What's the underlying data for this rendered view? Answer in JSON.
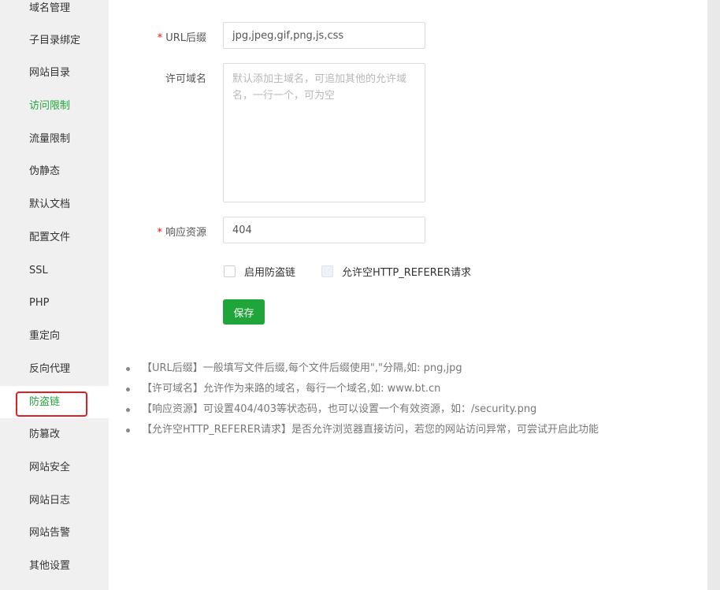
{
  "sidebar": {
    "items": [
      {
        "label": "域名管理"
      },
      {
        "label": "子目录绑定"
      },
      {
        "label": "网站目录"
      },
      {
        "label": "访问限制"
      },
      {
        "label": "流量限制"
      },
      {
        "label": "伪静态"
      },
      {
        "label": "默认文档"
      },
      {
        "label": "配置文件"
      },
      {
        "label": "SSL"
      },
      {
        "label": "PHP"
      },
      {
        "label": "重定向"
      },
      {
        "label": "反向代理"
      },
      {
        "label": "防盗链"
      },
      {
        "label": "防篡改"
      },
      {
        "label": "网站安全"
      },
      {
        "label": "网站日志"
      },
      {
        "label": "网站告警"
      },
      {
        "label": "其他设置"
      }
    ],
    "selected": "防盗链"
  },
  "form": {
    "required_mark": "*",
    "url_suffix": {
      "label": "URL后缀",
      "value": "jpg,jpeg,gif,png,js,css"
    },
    "allowed_domains": {
      "label": "许可域名",
      "value": "",
      "placeholder": "默认添加主域名，可追加其他的允许域名，一行一个，可为空"
    },
    "response_resource": {
      "label": "响应资源",
      "value": "404"
    },
    "enable_hotlink": {
      "label": "启用防盗链",
      "checked": false
    },
    "allow_empty_referer": {
      "label": "允许空HTTP_REFERER请求",
      "checked": false
    },
    "save_label": "保存"
  },
  "help": [
    "【URL后缀】一般填写文件后缀,每个文件后缀使用\",\"分隔,如: png,jpg",
    "【许可域名】允许作为来路的域名，每行一个域名,如: www.bt.cn",
    "【响应资源】可设置404/403等状态码，也可以设置一个有效资源，如：/security.png",
    "【允许空HTTP_REFERER请求】是否允许浏览器直接访问，若您的网站访问异常，可尝试开启此功能"
  ],
  "colors": {
    "accent": "#20a53a",
    "required": "#ef0808",
    "highlight_box": "#e02020"
  }
}
